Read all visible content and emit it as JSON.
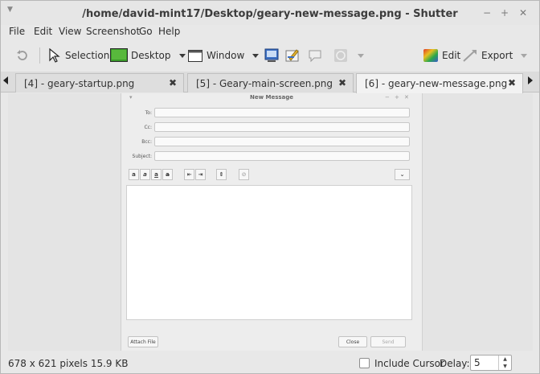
{
  "window": {
    "title": "/home/david-mint17/Desktop/geary-new-message.png - Shutter",
    "menu_icon": "window-menu-icon",
    "controls": [
      "minimize-icon",
      "maximize-icon",
      "close-icon"
    ]
  },
  "menubar": {
    "items": [
      "File",
      "Edit",
      "View",
      "Screenshot",
      "Go",
      "Help"
    ]
  },
  "toolbar": {
    "redo_icon": "redo-icon",
    "selection_label": "Selection",
    "desktop_label": "Desktop",
    "window_label": "Window",
    "edit_label": "Edit",
    "export_label": "Export"
  },
  "tabs": [
    {
      "label": "[4] - geary-startup.png",
      "active": false
    },
    {
      "label": "[5] - Geary-main-screen.png",
      "active": false
    },
    {
      "label": "[6] - geary-new-message.png",
      "active": true
    }
  ],
  "screenshot": {
    "window_title": "New Message",
    "labels": {
      "to": "To:",
      "cc": "Cc:",
      "bcc": "Bcc:",
      "subject": "Subject:"
    },
    "format_buttons": [
      "a",
      "a",
      "a",
      "a"
    ],
    "attach_label": "Attach File",
    "close_label": "Close",
    "send_label": "Send"
  },
  "statusbar": {
    "info": "678 x 621 pixels  15.9 KB",
    "include_cursor_label": "Include Cursor",
    "include_cursor_checked": false,
    "delay_label": "Delay:",
    "delay_value": "5"
  },
  "colors": {
    "window_bg": "#e8e8e8",
    "active_tab_bg": "#f2f2f2",
    "desktop_icon": "#3a9a2a",
    "edit_icon": "#e24a2a"
  }
}
